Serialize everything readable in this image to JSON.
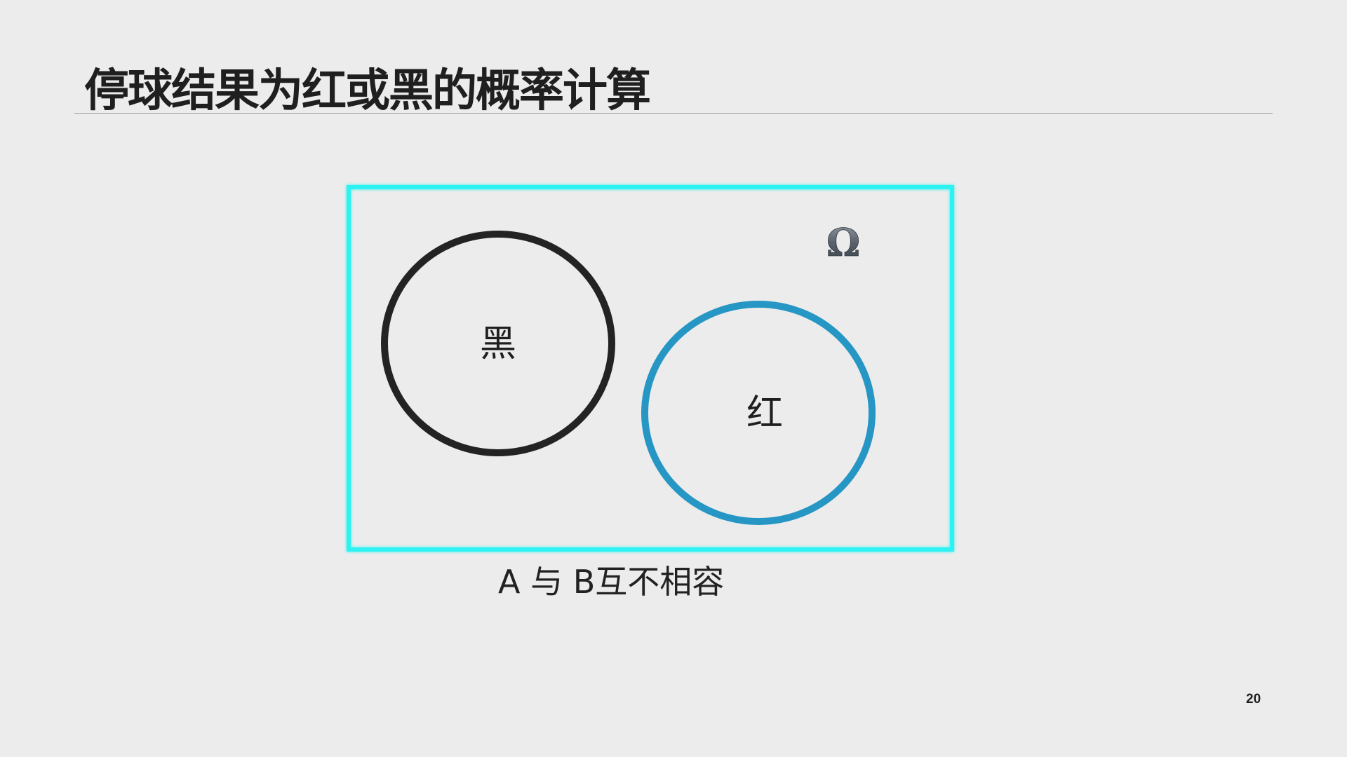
{
  "slide": {
    "title": "停球结果为红或黑的概率计算",
    "page_number": "20"
  },
  "diagram": {
    "universe_label": "Ω",
    "sets": [
      {
        "label": "黑",
        "color": "#232323"
      },
      {
        "label": "红",
        "color": "#2696c4"
      }
    ],
    "frame_color": "#2ef2f2",
    "caption": {
      "part_a": "A ",
      "part_mid": "与",
      "part_b": " B",
      "part_end": "互不相容"
    }
  }
}
